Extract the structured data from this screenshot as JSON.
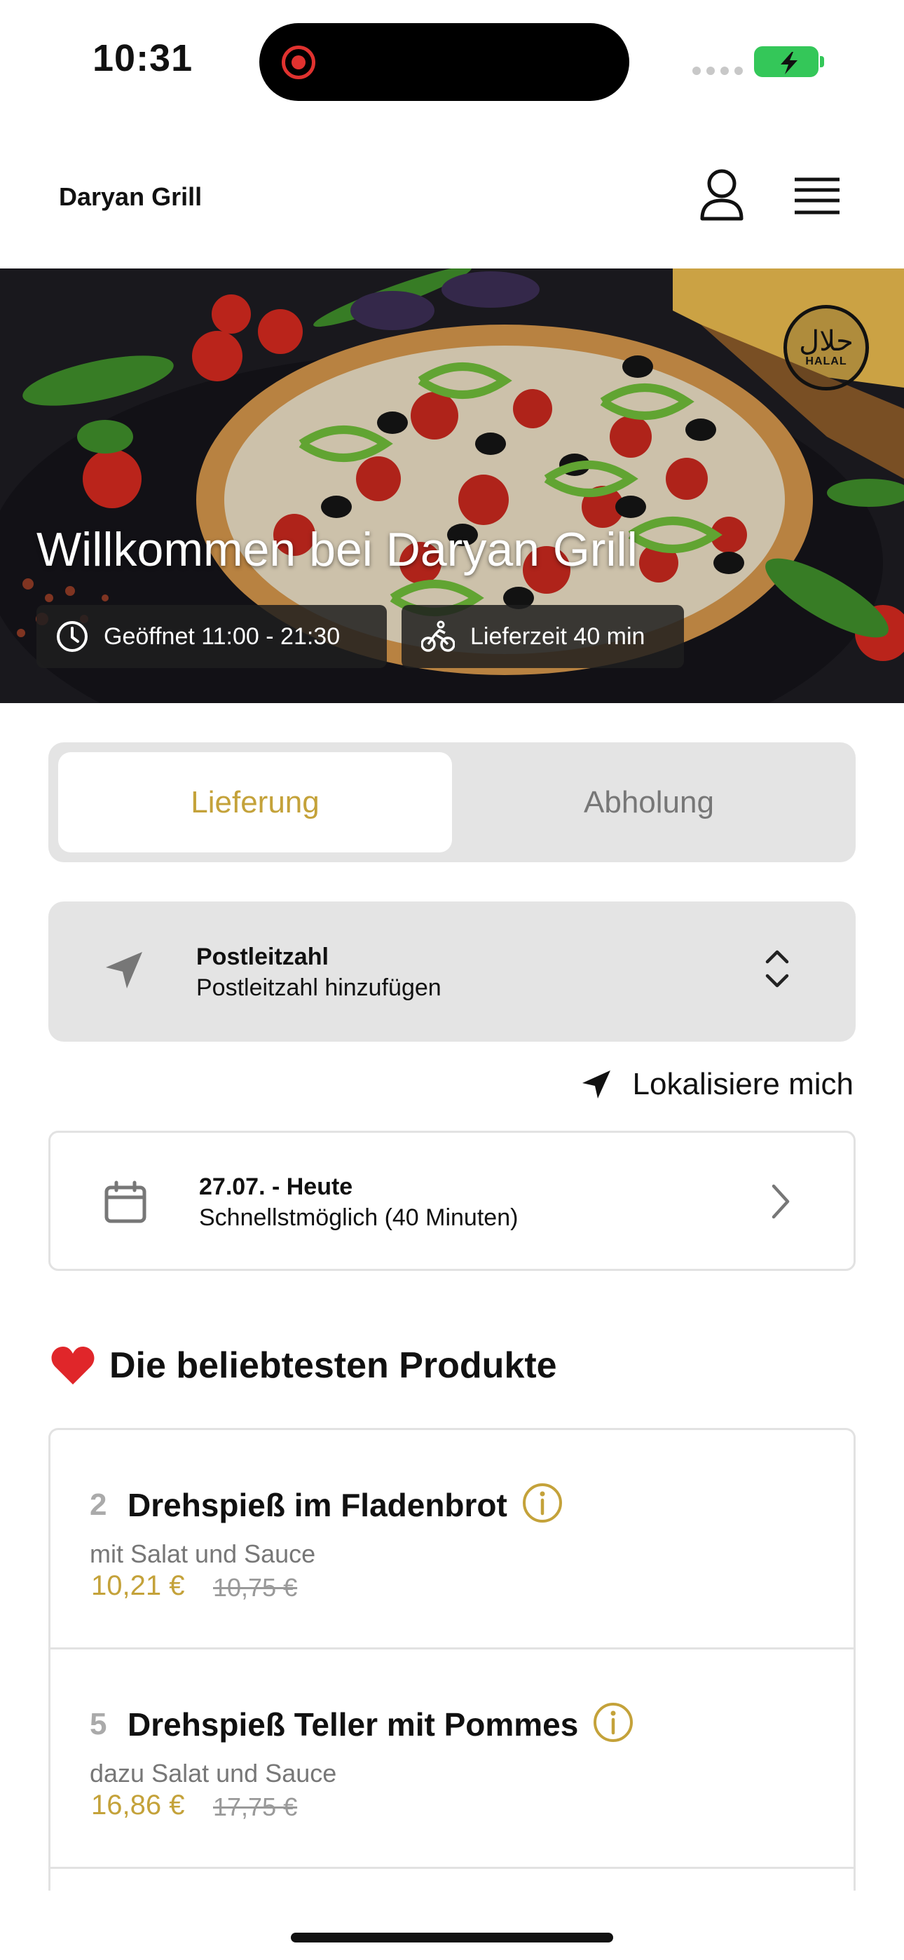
{
  "status_bar": {
    "time": "10:31"
  },
  "header": {
    "brand": "Daryan Grill"
  },
  "hero": {
    "title": "Willkommen bei Daryan Grill",
    "badge_arabic": "حلال",
    "badge_latin": "HALAL",
    "opening_hours": "Geöffnet 11:00 - 21:30",
    "delivery_time": "Lieferzeit 40 min"
  },
  "order_mode": {
    "options": [
      "Lieferung",
      "Abholung"
    ],
    "selected": "Lieferung"
  },
  "postcode": {
    "label": "Postleitzahl",
    "placeholder": "Postleitzahl hinzufügen"
  },
  "localize_label": "Lokalisiere mich",
  "date_select": {
    "date": "27.07. - Heute",
    "time": "Schnellstmöglich (40 Minuten)"
  },
  "popular": {
    "emoji": "❤️",
    "title": "Die beliebtesten Produkte",
    "products": [
      {
        "number": "2",
        "name": "Drehspieß im Fladenbrot",
        "description": "mit Salat und Sauce",
        "price": "10,21 €",
        "old_price": "10,75 €"
      },
      {
        "number": "5",
        "name": "Drehspieß Teller mit Pommes",
        "description": "dazu Salat und Sauce",
        "price": "16,86 €",
        "old_price": "17,75 €"
      }
    ]
  },
  "colors": {
    "accent": "#c4a23a",
    "panel": "#e4e4e4",
    "battery": "#34c759"
  },
  "icons": [
    "record-icon",
    "battery-icon",
    "user-icon",
    "menu-icon",
    "clock-icon",
    "bike-icon",
    "navigation-arrow-icon",
    "chevron-up-down-icon",
    "location-arrow-icon",
    "calendar-icon",
    "chevron-right-icon",
    "info-icon",
    "heart-icon"
  ]
}
